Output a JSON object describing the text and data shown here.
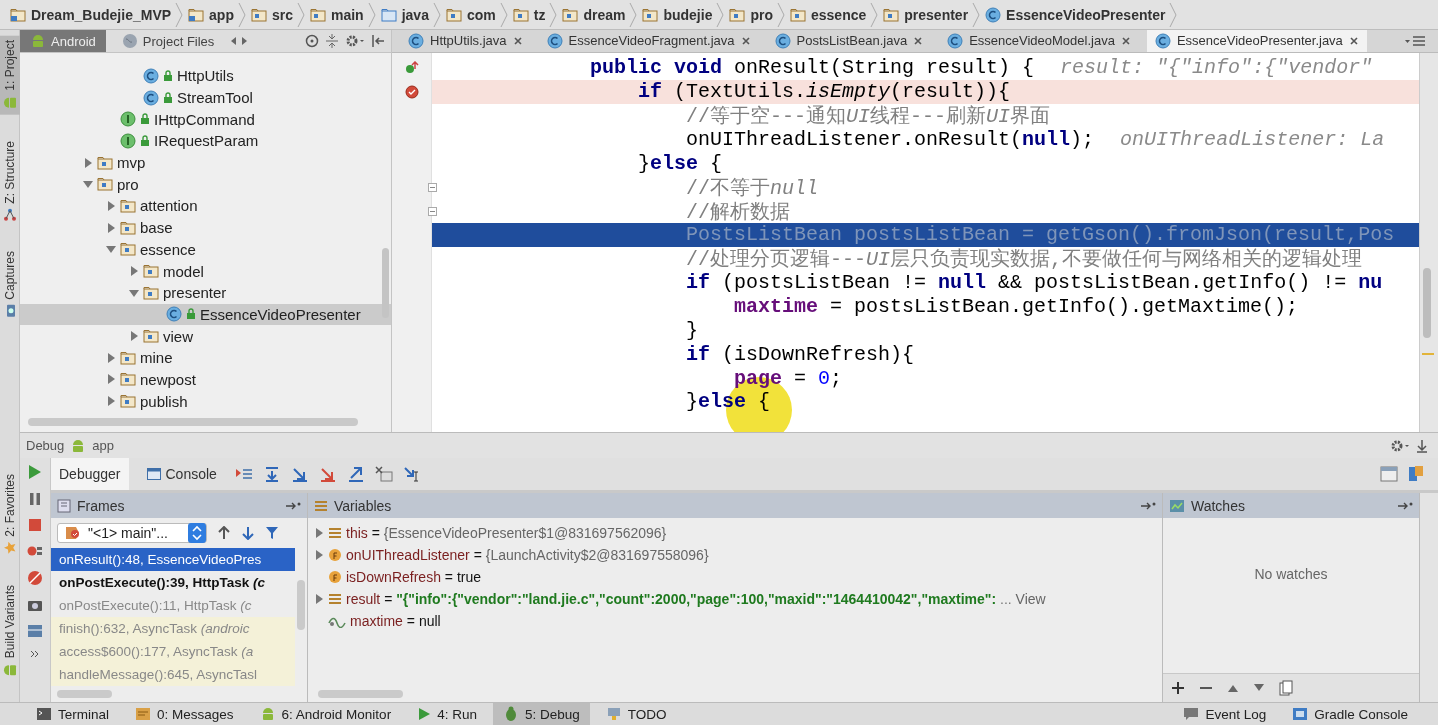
{
  "breadcrumbs": [
    {
      "label": "Dream_Budejie_MVP",
      "kind": "module"
    },
    {
      "label": "app",
      "kind": "module"
    },
    {
      "label": "src",
      "kind": "folder"
    },
    {
      "label": "main",
      "kind": "folder"
    },
    {
      "label": "java",
      "kind": "source"
    },
    {
      "label": "com",
      "kind": "package"
    },
    {
      "label": "tz",
      "kind": "package"
    },
    {
      "label": "dream",
      "kind": "package"
    },
    {
      "label": "budejie",
      "kind": "package"
    },
    {
      "label": "pro",
      "kind": "package"
    },
    {
      "label": "essence",
      "kind": "package"
    },
    {
      "label": "presenter",
      "kind": "package"
    },
    {
      "label": "EssenceVideoPresenter",
      "kind": "class"
    }
  ],
  "side_tools": {
    "top": [
      {
        "label": "1: Project",
        "kind": "android",
        "selected": true
      },
      {
        "label": "Z: Structure",
        "kind": "structure",
        "selected": false
      },
      {
        "label": "Captures",
        "kind": "camera",
        "selected": false
      }
    ],
    "bottom": [
      {
        "label": "2: Favorites",
        "kind": "star",
        "selected": false
      },
      {
        "label": "Build Variants",
        "kind": "android",
        "selected": false
      }
    ]
  },
  "project_panel": {
    "tabs": [
      {
        "label": "Android",
        "kind": "android",
        "selected": true
      },
      {
        "label": "Project Files",
        "kind": "globe",
        "selected": false
      }
    ]
  },
  "tree": {
    "items": [
      {
        "children": [
          {
            "children": [
              {
                "label": "HttpUtils",
                "kind": "class",
                "selected": false
              },
              {
                "label": "StreamTool",
                "kind": "class",
                "selected": false
              }
            ]
          },
          {
            "label": "IHttpCommand",
            "kind": "interface",
            "selected": false
          },
          {
            "label": "IRequestParam",
            "kind": "interface",
            "selected": false
          }
        ]
      },
      {
        "label": "mvp",
        "kind": "folder",
        "expanded": false,
        "selected": false
      },
      {
        "label": "pro",
        "kind": "folder",
        "expanded": true,
        "selected": false,
        "children": [
          {
            "label": "attention",
            "kind": "folder",
            "expanded": false,
            "selected": false
          },
          {
            "label": "base",
            "kind": "folder",
            "expanded": false,
            "selected": false
          },
          {
            "label": "essence",
            "kind": "folder",
            "expanded": true,
            "selected": false,
            "children": [
              {
                "label": "model",
                "kind": "folder",
                "expanded": false,
                "selected": false
              },
              {
                "label": "presenter",
                "kind": "folder",
                "expanded": true,
                "selected": false,
                "children": [
                  {
                    "label": "EssenceVideoPresenter",
                    "kind": "class",
                    "selected": true
                  }
                ]
              },
              {
                "label": "view",
                "kind": "folder",
                "expanded": false,
                "selected": false
              }
            ]
          },
          {
            "label": "mine",
            "kind": "folder",
            "expanded": false,
            "selected": false
          },
          {
            "label": "newpost",
            "kind": "folder",
            "expanded": false,
            "selected": false
          },
          {
            "label": "publish",
            "kind": "folder",
            "expanded": false,
            "selected": false
          }
        ]
      }
    ]
  },
  "editor_tabs": [
    {
      "label": "HttpUtils.java",
      "selected": false
    },
    {
      "label": "EssenceVideoFragment.java",
      "selected": false
    },
    {
      "label": "PostsListBean.java",
      "selected": false
    },
    {
      "label": "EssenceVideoModel.java",
      "selected": false
    },
    {
      "label": "EssenceVideoPresenter.java",
      "selected": true
    }
  ],
  "code": {
    "lines": [
      {
        "overrides": true,
        "breakpoint": false,
        "current": false,
        "foldable": false,
        "segments": [
          {
            "kind": "keyword",
            "text": "public void "
          },
          {
            "kind": "plain",
            "text": "onResult(String result) {"
          }
        ],
        "hint": "result: \"{\"info\":{\"vendor\""
      },
      {
        "overrides": false,
        "breakpoint": true,
        "current": false,
        "foldable": false,
        "segments": [
          {
            "kind": "keyword",
            "text": "    if "
          },
          {
            "kind": "plain",
            "text": "(TextUtils."
          },
          {
            "kind": "italic",
            "text": "isEmpty"
          },
          {
            "kind": "plain",
            "text": "(result)){"
          }
        ]
      },
      {
        "overrides": false,
        "breakpoint": false,
        "current": false,
        "foldable": false,
        "segments": [
          {
            "kind": "comment",
            "text": "        //等于空---通知"
          },
          {
            "kind": "comment-italic",
            "text": "UI"
          },
          {
            "kind": "comment",
            "text": "线程---刷新"
          },
          {
            "kind": "comment-italic",
            "text": "UI"
          },
          {
            "kind": "comment",
            "text": "界面"
          }
        ]
      },
      {
        "overrides": false,
        "breakpoint": false,
        "current": false,
        "foldable": false,
        "segments": [
          {
            "kind": "plain",
            "text": "        onUIThreadListener.onResult("
          },
          {
            "kind": "keyword",
            "text": "null"
          },
          {
            "kind": "plain",
            "text": ");"
          }
        ],
        "hint": "onUIThreadListener: La"
      },
      {
        "overrides": false,
        "breakpoint": false,
        "current": false,
        "foldable": false,
        "segments": [
          {
            "kind": "plain",
            "text": "    }"
          },
          {
            "kind": "keyword",
            "text": "else"
          },
          {
            "kind": "plain",
            "text": " {"
          }
        ]
      },
      {
        "overrides": false,
        "breakpoint": false,
        "current": false,
        "foldable": true,
        "segments": [
          {
            "kind": "comment",
            "text": "        //不等于"
          },
          {
            "kind": "comment-italic",
            "text": "null"
          }
        ]
      },
      {
        "overrides": false,
        "breakpoint": false,
        "current": false,
        "foldable": true,
        "segments": [
          {
            "kind": "comment",
            "text": "        //解析数据"
          }
        ]
      },
      {
        "overrides": false,
        "breakpoint": false,
        "current": true,
        "foldable": false,
        "segments": [
          {
            "kind": "plain",
            "text": "        PostsListBean postsListBean = getGson().fromJson(result,Pos"
          }
        ]
      },
      {
        "overrides": false,
        "breakpoint": false,
        "current": false,
        "foldable": false,
        "segments": [
          {
            "kind": "comment",
            "text": "        //处理分页逻辑---"
          },
          {
            "kind": "comment-italic",
            "text": "UI"
          },
          {
            "kind": "comment",
            "text": "层只负责现实数据,不要做任何与网络相关的逻辑处理"
          }
        ]
      },
      {
        "overrides": false,
        "breakpoint": false,
        "current": false,
        "foldable": false,
        "segments": [
          {
            "kind": "keyword",
            "text": "        if "
          },
          {
            "kind": "plain",
            "text": "(postsListBean != "
          },
          {
            "kind": "keyword",
            "text": "null"
          },
          {
            "kind": "plain",
            "text": " && postsListBean.getInfo() != "
          },
          {
            "kind": "keyword",
            "text": "nu"
          }
        ]
      },
      {
        "overrides": false,
        "breakpoint": false,
        "current": false,
        "foldable": false,
        "segments": [
          {
            "kind": "field",
            "text": "            maxtime"
          },
          {
            "kind": "plain",
            "text": " = postsListBean.getInfo().getMaxtime();"
          }
        ]
      },
      {
        "overrides": false,
        "breakpoint": false,
        "current": false,
        "foldable": false,
        "segments": [
          {
            "kind": "plain",
            "text": "        }"
          }
        ]
      },
      {
        "overrides": false,
        "breakpoint": false,
        "current": false,
        "foldable": false,
        "segments": [
          {
            "kind": "keyword",
            "text": "        if "
          },
          {
            "kind": "plain",
            "text": "(isDownRefresh){"
          }
        ]
      },
      {
        "overrides": false,
        "breakpoint": false,
        "current": false,
        "foldable": false,
        "segments": [
          {
            "kind": "field",
            "text": "            page"
          },
          {
            "kind": "plain",
            "text": " = "
          },
          {
            "kind": "number",
            "text": "0"
          },
          {
            "kind": "plain",
            "text": ";"
          }
        ]
      },
      {
        "overrides": false,
        "breakpoint": false,
        "current": false,
        "foldable": false,
        "segments": [
          {
            "kind": "plain",
            "text": "        }"
          },
          {
            "kind": "keyword",
            "text": "else"
          },
          {
            "kind": "plain",
            "text": " {"
          }
        ]
      }
    ]
  },
  "debug": {
    "title": "Debug",
    "config": "app",
    "tabs": [
      {
        "label": "Debugger",
        "selected": true
      },
      {
        "label": "Console",
        "selected": false
      }
    ],
    "frames": {
      "title": "Frames",
      "thread": "\"<1> main\"...",
      "items": [
        {
          "text": "onResult():48, EssenceVideoPres",
          "kind": "user",
          "selected": true
        },
        {
          "text": "onPostExecute():39, HttpTask *(c*",
          "kind": "user",
          "selected": false
        },
        {
          "text": "onPostExecute():11, HttpTask *(c*",
          "kind": "hidden",
          "selected": false
        },
        {
          "text": "finish():632, AsyncTask *(androic*",
          "kind": "library",
          "selected": false
        },
        {
          "text": "access$600():177, AsyncTask *(a*",
          "kind": "library",
          "selected": false
        },
        {
          "text": "handleMessage():645, AsyncTasl",
          "kind": "library",
          "selected": false
        }
      ]
    },
    "variables": {
      "title": "Variables",
      "items": [
        {
          "name": "this",
          "operator": "=",
          "value": "{EssenceVideoPresenter$1@831697562096}",
          "reference": true,
          "string": false,
          "kind": "object",
          "expandable": true
        },
        {
          "name": "onUIThreadListener",
          "operator": "=",
          "value": "{LaunchActivity$2@831697558096}",
          "reference": true,
          "string": false,
          "kind": "field",
          "expandable": true
        },
        {
          "name": "isDownRefresh",
          "operator": "=",
          "value": "true",
          "reference": false,
          "string": false,
          "kind": "field",
          "expandable": false
        },
        {
          "name": "result",
          "operator": "=",
          "value": "\"{\"info\":{\"vendor\":\"land.jie.c\",\"count\":2000,\"page\":100,\"maxid\":\"1464410042\",\"maxtime\":",
          "reference": false,
          "string": true,
          "kind": "object",
          "expandable": true,
          "overflow": "...",
          "link": "View"
        },
        {
          "name": "maxtime",
          "operator": "=",
          "value": "null",
          "reference": false,
          "string": false,
          "kind": "watch",
          "expandable": false
        }
      ]
    },
    "watches": {
      "title": "Watches",
      "empty": "No watches"
    }
  },
  "status_bar": {
    "left": [
      {
        "label": "Terminal",
        "kind": "terminal",
        "selected": false
      },
      {
        "label": "0: Messages",
        "kind": "messages",
        "selected": false
      },
      {
        "label": "6: Android Monitor",
        "kind": "android",
        "selected": false
      },
      {
        "label": "4: Run",
        "kind": "run",
        "selected": false
      },
      {
        "label": "5: Debug",
        "kind": "bug",
        "selected": true
      },
      {
        "label": "TODO",
        "kind": "todo",
        "selected": false
      }
    ],
    "right": [
      {
        "label": "Event Log",
        "kind": "log",
        "selected": false
      },
      {
        "label": "Gradle Console",
        "kind": "gradle",
        "selected": false
      }
    ]
  }
}
